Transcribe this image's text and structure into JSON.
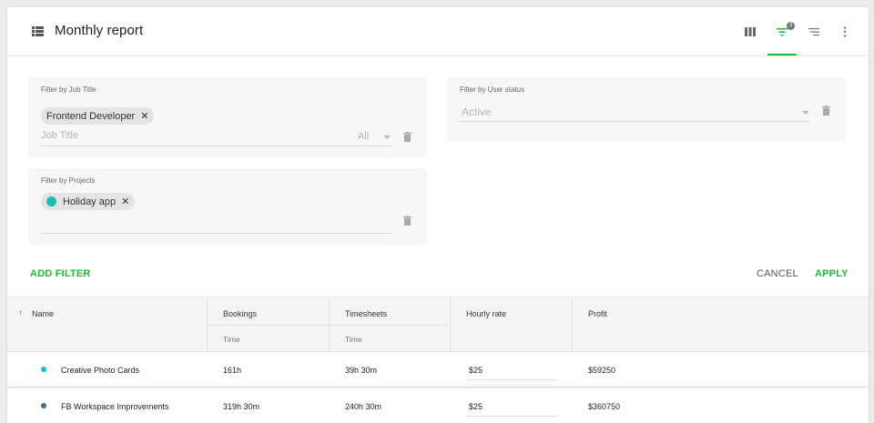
{
  "header": {
    "title": "Monthly report",
    "title_icon": "list-icon",
    "buttons": [
      {
        "name": "columns-button",
        "icon": "columns-icon"
      },
      {
        "name": "filter-button",
        "icon": "filter-icon",
        "badge": "3",
        "active": true
      },
      {
        "name": "sort-button",
        "icon": "sort-icon"
      },
      {
        "name": "more-button",
        "icon": "more-vertical-icon"
      }
    ]
  },
  "filters": {
    "job_title": {
      "label": "Filter by Job Title",
      "chip": "Frontend Developer",
      "placeholder": "Job Title",
      "scope": "All"
    },
    "user_status": {
      "label": "Filter by User status",
      "value": "Active"
    },
    "projects": {
      "label": "Filter by Projects",
      "chip": "Holiday app"
    }
  },
  "actions": {
    "add_filter": "ADD FILTER",
    "cancel": "CANCEL",
    "apply": "APPLY"
  },
  "table": {
    "columns": [
      {
        "label": "Name",
        "sub": ""
      },
      {
        "label": "Bookings",
        "sub": "Time"
      },
      {
        "label": "Timesheets",
        "sub": "Time"
      },
      {
        "label": "Hourly rate",
        "sub": ""
      },
      {
        "label": "Profit",
        "sub": ""
      }
    ],
    "rows": [
      {
        "name": "Creative Photo Cards",
        "dot_color": "#16bfd6",
        "bookings": "161h",
        "timesheets": "39h 30m",
        "rate": "$25",
        "profit": "$59250"
      },
      {
        "name": "FB Workspace Improvements",
        "dot_color": "#4a6a7a",
        "bookings": "319h 30m",
        "timesheets": "240h 30m",
        "rate": "$25",
        "profit": "$360750"
      }
    ]
  },
  "colors": {
    "accent": "#1db938",
    "chip_dot": "#1bbfb1"
  }
}
